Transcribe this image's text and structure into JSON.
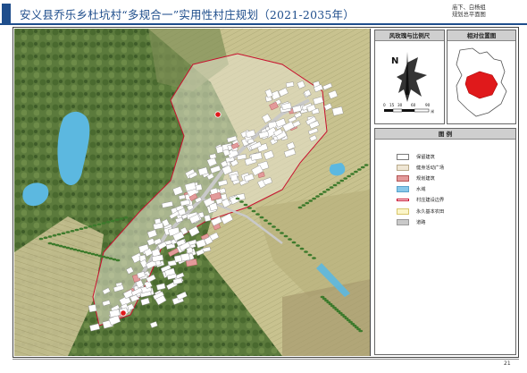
{
  "header": {
    "title": "安义县乔乐乡杜坑村“多规合一”实用性村庄规划（2021-2035年）",
    "drawing_title_line1": "庙下、白杨组",
    "drawing_title_line2": "规划总平面图",
    "accent_color": "#1f4e8c"
  },
  "compass_panel": {
    "title": "风玫瑰与比例尺",
    "north_label": "N",
    "scale_ticks": [
      "0",
      "15",
      "30",
      "60",
      "90"
    ],
    "scale_unit": "米"
  },
  "location_panel": {
    "title": "相对位置图",
    "highlight_color": "#e0191b"
  },
  "legend": {
    "title": "图    例",
    "items": [
      {
        "label": "保留建筑",
        "color": "#ffffff",
        "border": "#7a7a7a"
      },
      {
        "label": "健身活动广场",
        "color": "#efe6d4",
        "border": "#b8a98a"
      },
      {
        "label": "规划建筑",
        "color": "#e39a9a",
        "border": "#b45555"
      },
      {
        "label": "水域",
        "color": "#86c8ea",
        "border": "#5aa3cc"
      },
      {
        "label": "村庄建设边界",
        "color": "#ffffff",
        "border": "#c8102e"
      },
      {
        "label": "永久基本农田",
        "color": "#fbf5c8",
        "border": "#d8c66a"
      },
      {
        "label": "道路",
        "color": "#c9c9c9",
        "border": "#9a9a9a"
      }
    ]
  },
  "map": {
    "village_marker_color": "#e0191b",
    "water_color": "#5cb8e0",
    "hedge_color": "#3d7a2c"
  },
  "page_number": "21"
}
